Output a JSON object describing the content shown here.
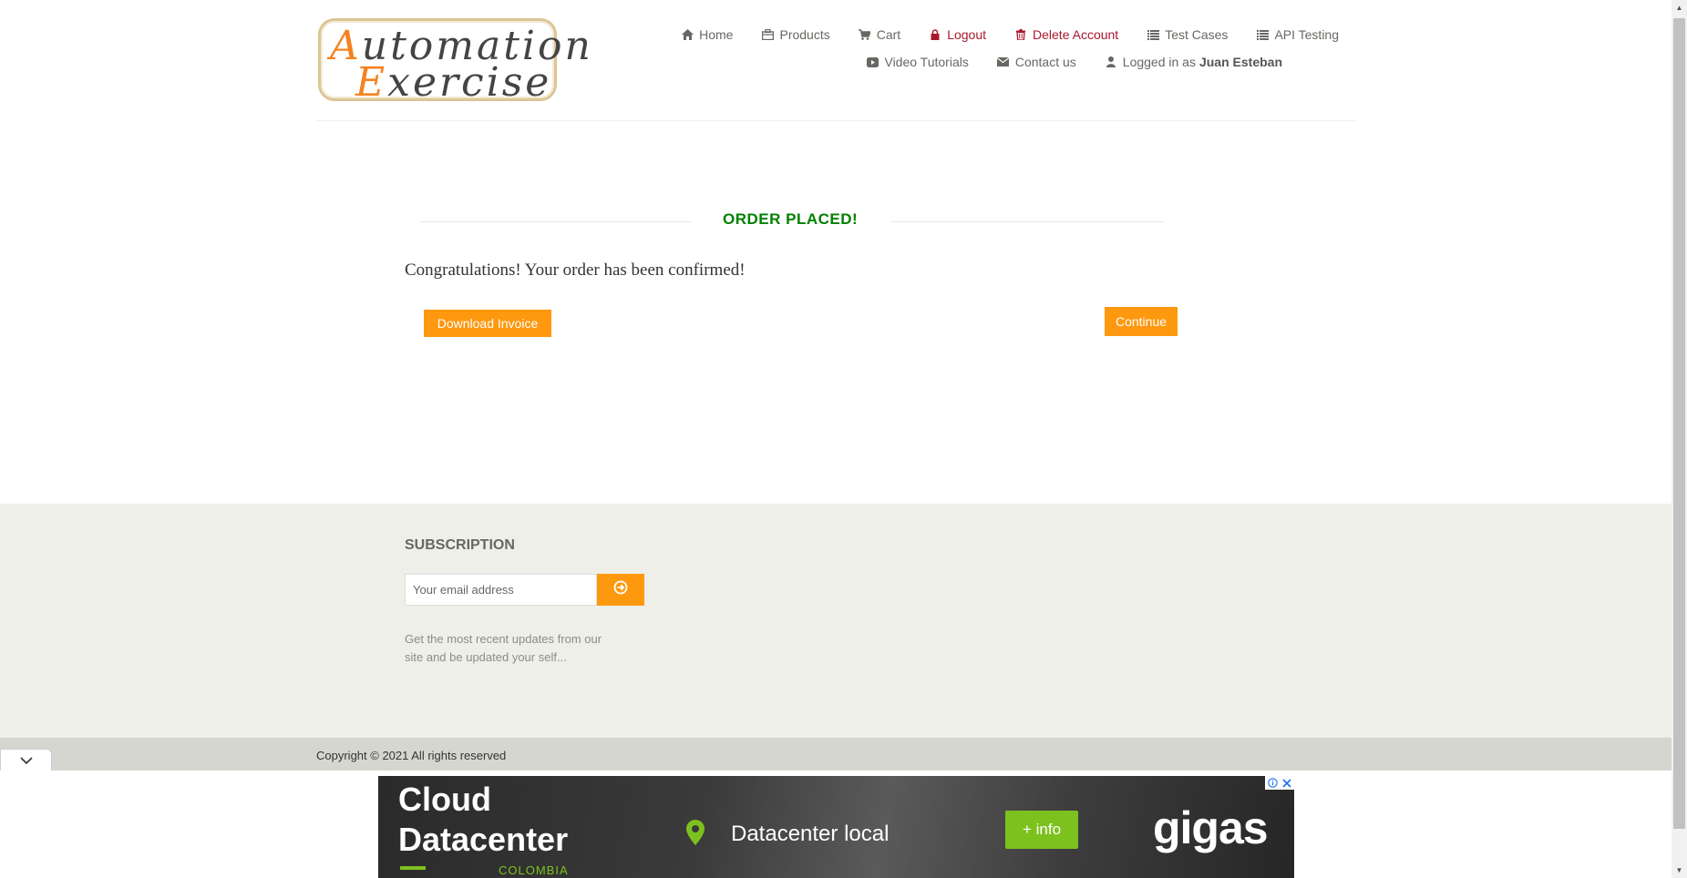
{
  "logo": {
    "line1_cap": "A",
    "line1_rest": "utomation",
    "line2_cap": "E",
    "line2_rest": "xercise"
  },
  "nav": {
    "row1": [
      {
        "label": "Home",
        "icon": "home-icon"
      },
      {
        "label": "Products",
        "icon": "products-icon"
      },
      {
        "label": "Cart",
        "icon": "cart-icon"
      },
      {
        "label": "Logout",
        "icon": "lock-icon"
      },
      {
        "label": "Delete Account",
        "icon": "trash-icon"
      },
      {
        "label": "Test Cases",
        "icon": "list-icon"
      },
      {
        "label": "API Testing",
        "icon": "list-icon"
      }
    ],
    "row2": [
      {
        "label": "Video Tutorials",
        "icon": "youtube-icon"
      },
      {
        "label": "Contact us",
        "icon": "envelope-icon"
      },
      {
        "label": "Logged in as",
        "icon": "user-icon",
        "username": "Juan Esteban"
      }
    ]
  },
  "order": {
    "title": "ORDER PLACED!",
    "message": "Congratulations! Your order has been confirmed!",
    "download_label": "Download Invoice",
    "continue_label": "Continue"
  },
  "footer": {
    "subscription_title": "SUBSCRIPTION",
    "email_placeholder": "Your email address",
    "description": "Get the most recent updates from our site and be updated your self...",
    "copyright": "Copyright © 2021 All rights reserved"
  },
  "ad": {
    "title_line1": "Cloud",
    "title_line2": "Datacenter",
    "country": "COLOMBIA",
    "tagline": "Datacenter local",
    "button": "+ info",
    "brand": "gigas"
  },
  "colors": {
    "accent": "#fe980f",
    "success": "#008000",
    "danger": "#a8182c",
    "ad_green": "#7dc11f"
  }
}
